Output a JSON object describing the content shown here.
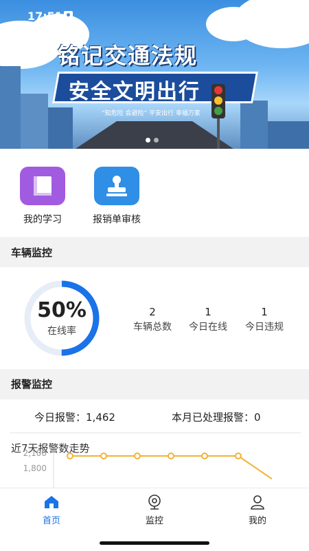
{
  "status_bar": {
    "time": "17:51"
  },
  "banner": {
    "title_line1": "铭记交通法规",
    "title_line2": "安全文明出行",
    "slogan": "“知危险 会避险”  平安出行 幸福万家"
  },
  "quick_actions": [
    {
      "label": "我的学习",
      "icon": "book-icon",
      "color": "#a15be0"
    },
    {
      "label": "报销单审核",
      "icon": "stamp-icon",
      "color": "#2f8ee6"
    }
  ],
  "vehicle_monitor": {
    "title": "车辆监控",
    "online_rate": 0.5,
    "online_rate_text": "50%",
    "online_rate_label": "在线率",
    "stats": [
      {
        "value": "2",
        "label": "车辆总数"
      },
      {
        "value": "1",
        "label": "今日在线"
      },
      {
        "value": "1",
        "label": "今日违规"
      }
    ]
  },
  "alarm_monitor": {
    "title": "报警监控",
    "today_label": "今日报警：",
    "today_value": "1,462",
    "month_label": "本月已处理报警：",
    "month_value": "0",
    "trend_title": "近7天报警数走势",
    "chart_data": {
      "type": "line",
      "y_ticks": [
        "2,100",
        "1,800"
      ],
      "values": [
        2000,
        2000,
        2000,
        2000,
        2000,
        2000,
        1750
      ],
      "ylim": [
        1700,
        2150
      ]
    }
  },
  "tabbar": {
    "items": [
      {
        "label": "首页",
        "icon": "home-icon",
        "active": true
      },
      {
        "label": "监控",
        "icon": "monitor-icon",
        "active": false
      },
      {
        "label": "我的",
        "icon": "user-icon",
        "active": false
      }
    ]
  },
  "colors": {
    "accent": "#1a73e8",
    "chart_line": "#f2b233",
    "ring_track": "#e6edf7"
  }
}
